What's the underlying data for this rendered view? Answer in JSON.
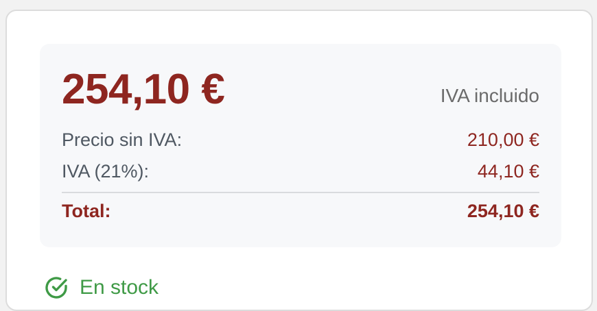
{
  "price": {
    "main": "254,10 €",
    "vat_note": "IVA incluido"
  },
  "breakdown": {
    "net_label": "Precio sin IVA:",
    "net_value": "210,00 €",
    "vat_label": "IVA (21%):",
    "vat_value": "44,10 €",
    "total_label": "Total:",
    "total_value": "254,10 €"
  },
  "stock": {
    "label": "En stock",
    "icon": "check-circle-icon",
    "color": "#3f9a46"
  },
  "colors": {
    "accent": "#8e2620",
    "panel": "#f7f8fa"
  }
}
